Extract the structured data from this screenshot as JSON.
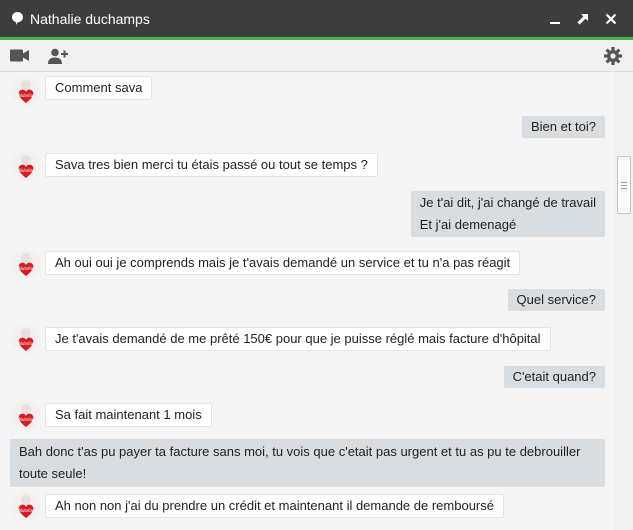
{
  "window": {
    "title": "Nathalie duchamps",
    "accent_color": "#4caf50",
    "titlebar_color": "#3d3d3d",
    "controls": [
      "minimize-icon",
      "popout-icon",
      "close-icon"
    ]
  },
  "toolbar": {
    "buttons": [
      "video-call-icon",
      "add-person-icon",
      "settings-gear-icon"
    ]
  },
  "messages": [
    {
      "from": "them",
      "text": "Comment sava"
    },
    {
      "from": "me",
      "text": "Bien et toi?"
    },
    {
      "from": "them",
      "text": "Sava tres bien merci tu étais passé ou tout se temps ?"
    },
    {
      "from": "me",
      "line1": "Je t'ai dit, j'ai changé de travail",
      "line2": "Et j'ai demenagé"
    },
    {
      "from": "them",
      "text": "Ah oui oui je comprends mais je t'avais demandé un service et tu n'a pas réagit"
    },
    {
      "from": "me",
      "text": "Quel service?"
    },
    {
      "from": "them",
      "text": "Je t'avais demandé de me prêté 150€ pour que je puisse réglé mais facture d'hôpital"
    },
    {
      "from": "me",
      "text": "C'etait quand?"
    },
    {
      "from": "them",
      "text": "Sa fait maintenant 1 mois"
    },
    {
      "from": "me",
      "text": "Bah donc t'as pu payer ta facture sans moi, tu vois que c'etait pas urgent et tu as pu te debrouiller toute seule!"
    },
    {
      "from": "them",
      "text": "Ah non non j'ai du prendre un crédit et maintenant il demande de remboursé"
    }
  ]
}
